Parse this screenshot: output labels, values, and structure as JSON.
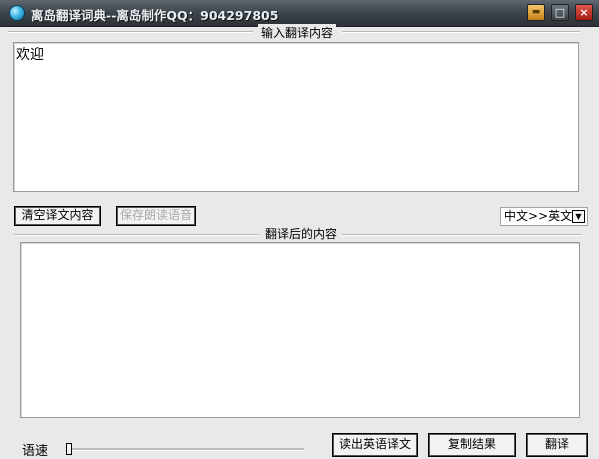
{
  "window": {
    "title": "离岛翻译词典--离岛制作QQ：904297805",
    "icons": {
      "app": "globe-icon",
      "menu": "menu-icon",
      "maximize": "maximize-icon",
      "close": "close-icon"
    },
    "menu_glyph": "▬",
    "maximize_glyph": "□",
    "close_glyph": "×"
  },
  "input_group": {
    "caption": "输入翻译内容",
    "text": "欢迎"
  },
  "toolbar": {
    "clear_label": "清空译文内容",
    "save_voice_label": "保存朗读语音",
    "direction_value": "中文>>英文",
    "dropdown_glyph": "▼"
  },
  "output_group": {
    "caption": "翻译后的内容",
    "text": ""
  },
  "bottom": {
    "speed_label": "语速",
    "speed_level": 0.0,
    "read_english_label": "读出英语译文",
    "copy_label": "复制结果",
    "translate_label": "翻译"
  },
  "colors": {
    "titlebar": "#3e464d",
    "close_button": "#c8281c",
    "window_bg": "#e9e9e9"
  }
}
